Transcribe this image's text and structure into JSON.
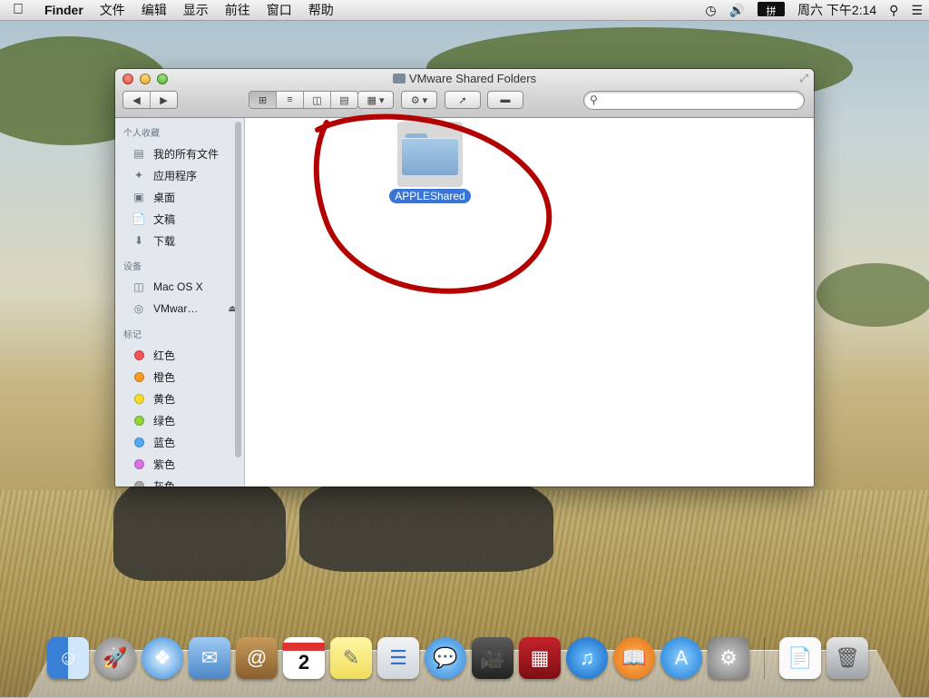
{
  "menubar": {
    "apple_icon": "apple-icon",
    "app_name": "Finder",
    "menus": [
      "文件",
      "编辑",
      "显示",
      "前往",
      "窗口",
      "帮助"
    ],
    "input_method": "拼",
    "clock": "周六 下午2:14"
  },
  "window": {
    "title": "VMware Shared Folders",
    "toolbar": {
      "back": "◀",
      "forward": "▶",
      "view_modes": [
        "icon-view",
        "list-view",
        "column-view",
        "coverflow-view"
      ],
      "arrange": "arrange-menu",
      "action": "action-gear-menu",
      "share": "share",
      "tags": "tags",
      "search_placeholder": ""
    },
    "sidebar": {
      "favorites_header": "个人收藏",
      "favorites": [
        {
          "label": "我的所有文件",
          "icon": "all-files-icon"
        },
        {
          "label": "应用程序",
          "icon": "applications-icon"
        },
        {
          "label": "桌面",
          "icon": "desktop-icon"
        },
        {
          "label": "文稿",
          "icon": "documents-icon"
        },
        {
          "label": "下载",
          "icon": "downloads-icon"
        }
      ],
      "devices_header": "设备",
      "devices": [
        {
          "label": "Mac OS X",
          "icon": "hard-disk-icon"
        },
        {
          "label": "VMwar…",
          "icon": "disc-icon",
          "eject": "⏏"
        }
      ],
      "tags_header": "标记",
      "tags": [
        {
          "label": "红色",
          "color": "#f0545a"
        },
        {
          "label": "橙色",
          "color": "#f89b24"
        },
        {
          "label": "黄色",
          "color": "#f7dd2a"
        },
        {
          "label": "绿色",
          "color": "#8fd33d"
        },
        {
          "label": "蓝色",
          "color": "#56a9f2"
        },
        {
          "label": "紫色",
          "color": "#d873e6"
        },
        {
          "label": "灰色",
          "color": "#a8a8a8"
        }
      ]
    },
    "content": {
      "items": [
        {
          "name": "APPLEShared",
          "selected": true,
          "icon": "folder-icon"
        }
      ]
    }
  },
  "dock": {
    "apps": [
      "finder",
      "launchpad",
      "safari",
      "mail",
      "contacts",
      "calendar",
      "notes",
      "reminders",
      "messages",
      "facetime",
      "photo-booth",
      "itunes",
      "ibooks",
      "app-store",
      "system-preferences",
      "documents",
      "trash"
    ],
    "calendar_day": "2"
  }
}
